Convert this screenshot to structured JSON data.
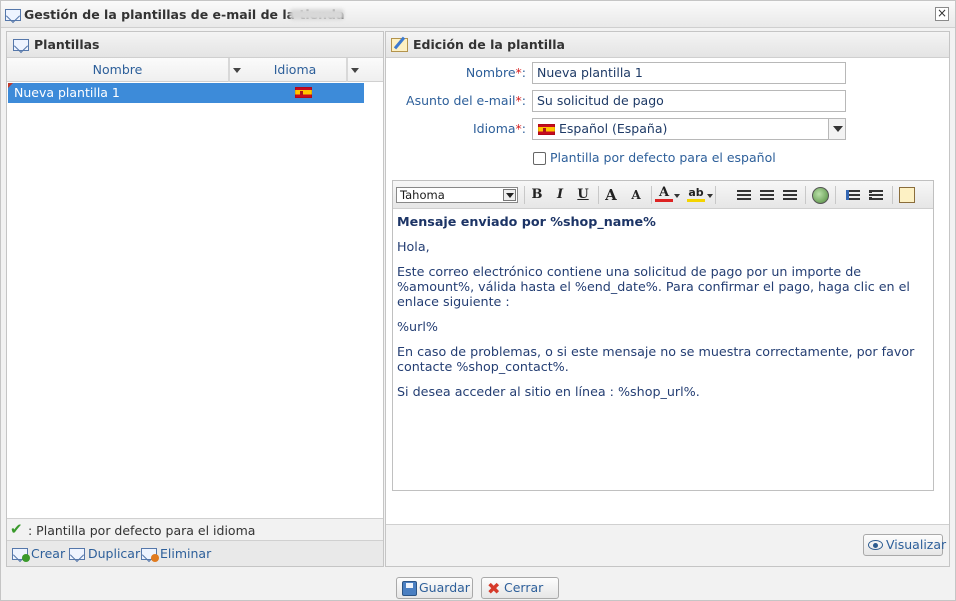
{
  "window": {
    "title": "Gestión de la plantillas de e-mail de la tienda",
    "close_glyph": "×"
  },
  "left_panel": {
    "title": "Plantillas",
    "columns": [
      "Nombre",
      "Idioma"
    ],
    "rows": [
      {
        "name": "Nueva plantilla 1",
        "language_flag": "flag-es-icon",
        "selected": true
      }
    ],
    "legend_text": ": Plantilla por defecto para el idioma",
    "actions": {
      "create": "Crear",
      "duplicate": "Duplicar",
      "delete": "Eliminar"
    }
  },
  "right_panel": {
    "title": "Edición de la plantilla",
    "form": {
      "name_label": "Nombre",
      "name_value": "Nueva plantilla 1",
      "subject_label": "Asunto del e-mail",
      "subject_value": "Su solicitud de pago",
      "language_label": "Idioma",
      "language_value": "Español (España)",
      "required_mark": "*",
      "label_suffix": ":",
      "default_checkbox_label": "Plantilla por defecto para el español",
      "default_checked": false
    },
    "editor": {
      "font_family_value": "Tahoma",
      "toolbar": {
        "bold": "B",
        "italic": "I",
        "underline": "U",
        "grow_font": "A",
        "shrink_font": "A",
        "font_color": "A",
        "highlight": "ab"
      },
      "content": {
        "heading": "Mensaje enviado por %shop_name%",
        "greeting": "Hola,",
        "para1": "Este correo electrónico contiene una solicitud de pago por un importe de %amount%, válida hasta el %end_date%. Para confirmar el pago, haga clic en el enlace siguiente :",
        "url": "%url%",
        "para2": "En caso de problemas, o si este mensaje no se muestra correctamente, por favor contacte %shop_contact%.",
        "para3": "Si desea acceder al sitio en línea : %shop_url%."
      }
    },
    "preview_button": "Visualizar"
  },
  "footer": {
    "save_button": "Guardar",
    "close_button": "Cerrar"
  },
  "colors": {
    "selection": "#3d8bd9",
    "label_blue": "#2d5f9a",
    "required_red": "#d62020",
    "check_green": "#3a9a2c"
  }
}
